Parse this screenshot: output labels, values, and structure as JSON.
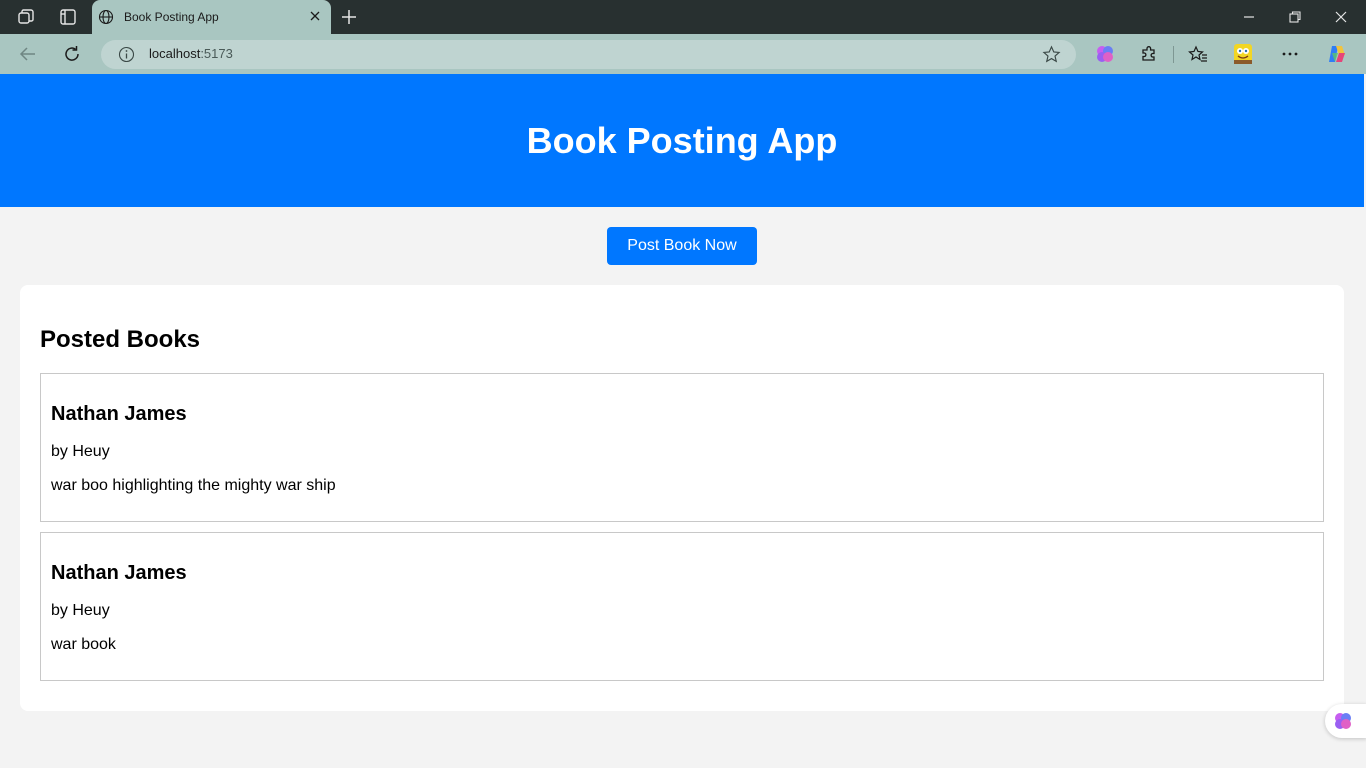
{
  "browser": {
    "tab_title": "Book Posting App",
    "url_host": "localhost",
    "url_port": ":5173"
  },
  "app": {
    "title": "Book Posting App",
    "post_button_label": "Post Book Now",
    "posted_heading": "Posted Books",
    "books": [
      {
        "title": "Nathan James",
        "author": "by Heuy",
        "description": "war boo highlighting the mighty war ship"
      },
      {
        "title": "Nathan James",
        "author": "by Heuy",
        "description": "war book"
      }
    ]
  },
  "colors": {
    "accent": "#0077ff",
    "chrome_dark": "#283030",
    "chrome_light": "#a9c6c1"
  },
  "icons": [
    "workspaces-icon",
    "tab-actions-icon",
    "globe-icon",
    "close-icon",
    "new-tab-icon",
    "minimize-icon",
    "restore-icon",
    "close-window-icon",
    "back-icon",
    "refresh-icon",
    "info-icon",
    "star-icon",
    "copilot-brain-icon",
    "extensions-icon",
    "favorites-icon",
    "profile-avatar-icon",
    "more-icon",
    "copilot-icon"
  ]
}
